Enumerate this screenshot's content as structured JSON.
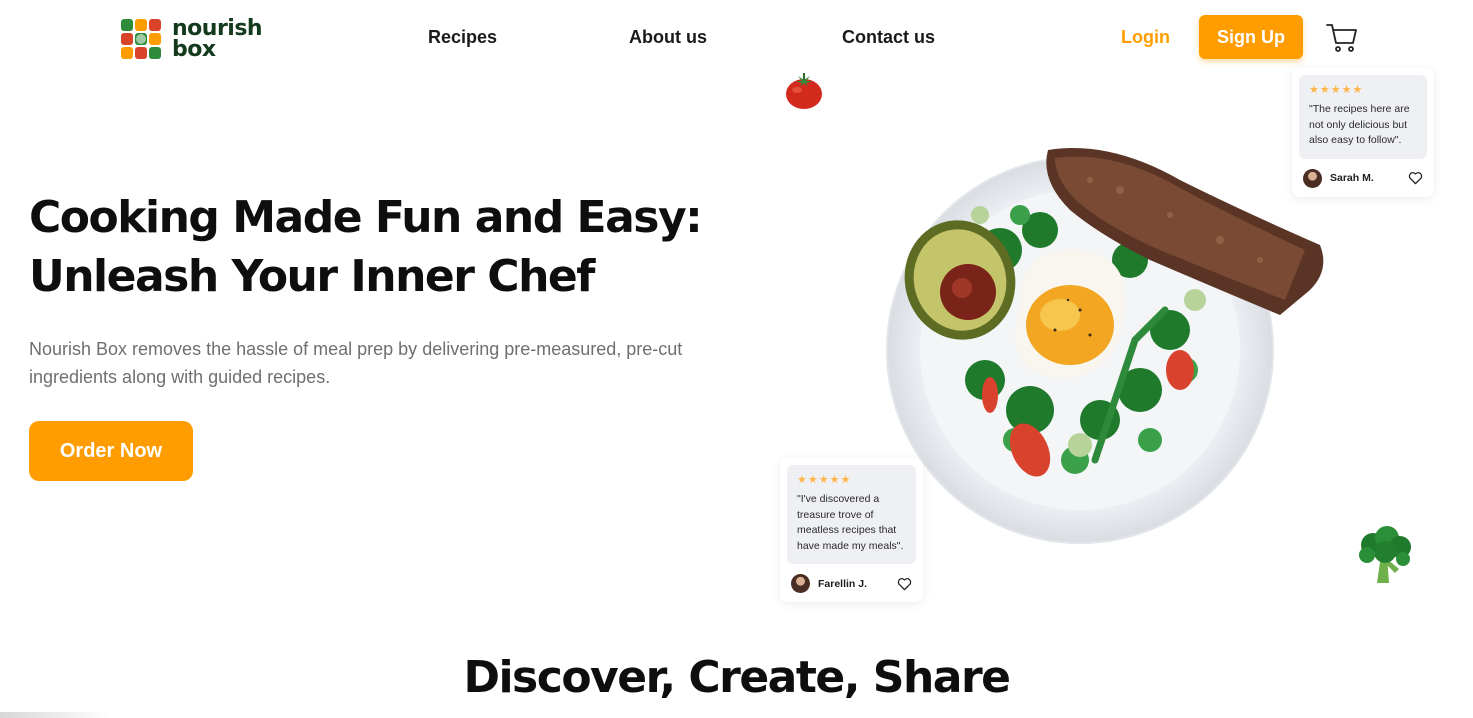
{
  "brand": {
    "name_line1": "nourish",
    "name_line2": "box",
    "colors": {
      "accent": "#ff9d00",
      "brand_dark": "#133a1c",
      "text": "#0e0e0e",
      "muted": "#6f6f6f"
    }
  },
  "nav": {
    "links": [
      "Recipes",
      "About us",
      "Contact us"
    ],
    "login_label": "Login",
    "signup_label": "Sign Up",
    "cart_icon": "cart-icon"
  },
  "hero": {
    "title_line1": "Cooking Made Fun and Easy:",
    "title_line2": "Unleash Your Inner Chef",
    "description": "Nourish Box removes the hassle of meal prep by delivering pre-measured, pre-cut ingredients along with guided recipes.",
    "cta_label": "Order Now"
  },
  "reviews": [
    {
      "stars": "★★★★★",
      "quote": "\"The recipes here are not only delicious but also easy to follow\".",
      "author": "Sarah M."
    },
    {
      "stars": "★★★★★",
      "quote": "\"I've discovered a treasure trove of meatless recipes that have made my meals\".",
      "author": "Farellin J."
    }
  ],
  "section": {
    "title": "Discover, Create, Share"
  }
}
